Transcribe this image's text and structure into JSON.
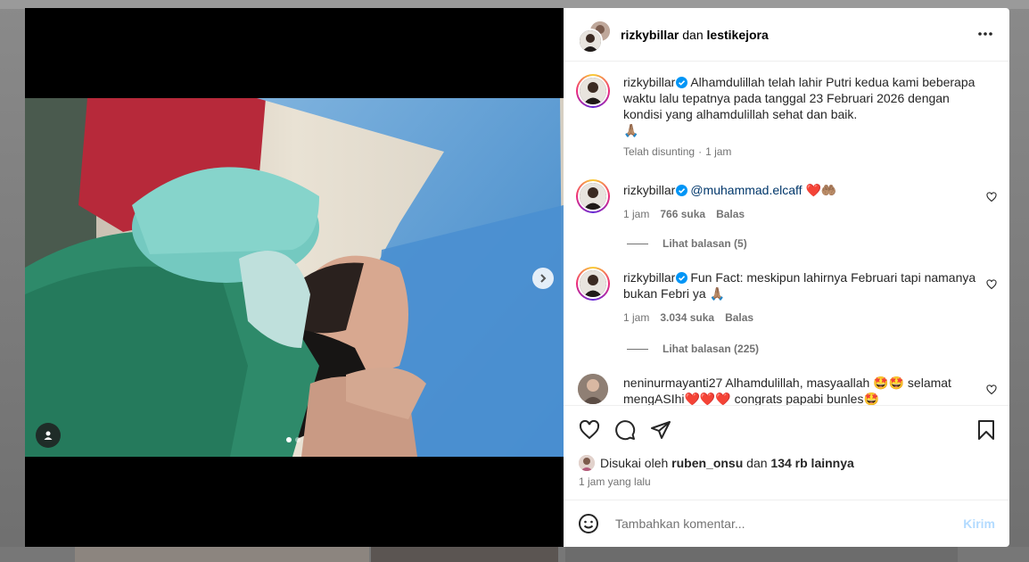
{
  "header": {
    "user1": "rizkybillar",
    "joiner": "dan",
    "user2": "lestikejora"
  },
  "caption": {
    "username": "rizkybillar",
    "text": "Alhamdulillah telah lahir Putri kedua kami beberapa waktu lalu tepatnya pada tanggal 23 Februari 2026 dengan kondisi yang alhamdulillah sehat dan baik.",
    "emoji": "🙏🏽",
    "edited": "Telah disunting",
    "separator": "·",
    "time": "1 jam"
  },
  "comments": [
    {
      "username": "rizkybillar",
      "mention": "@muhammad.elcaff",
      "text": " ❤️🤲🏽",
      "time": "1 jam",
      "likes": "766 suka",
      "reply": "Balas",
      "view_replies": "Lihat balasan (5)"
    },
    {
      "username": "rizkybillar",
      "text": "Fun Fact: meskipun lahirnya Februari tapi namanya bukan Febri ya 🙏🏽",
      "time": "1 jam",
      "likes": "3.034 suka",
      "reply": "Balas",
      "view_replies": "Lihat balasan (225)"
    },
    {
      "username": "neninurmayanti27",
      "text": "Alhamdulillah, masyaallah 🤩🤩 selamat mengASIhi❤️❤️❤️ congrats papabi bunles🤩"
    }
  ],
  "likes": {
    "prefix": "Disukai oleh",
    "user": "ruben_onsu",
    "joiner": "dan",
    "count": "134 rb lainnya"
  },
  "time_ago": "1 jam yang lalu",
  "add_comment": {
    "placeholder": "Tambahkan komentar...",
    "post_label": "Kirim"
  },
  "icons": {
    "more": "more-horizontal-icon",
    "heart": "heart-icon",
    "comment": "comment-icon",
    "share": "share-icon",
    "save": "bookmark-icon",
    "emoji": "emoji-icon",
    "next": "chevron-right-icon",
    "tag": "user-tag-icon",
    "verified": "verified-badge-icon"
  },
  "colors": {
    "link": "#00376b",
    "verified": "#0095f6",
    "post_disabled": "#b3dbff"
  },
  "carousel": {
    "slides": 2,
    "current": 1
  }
}
